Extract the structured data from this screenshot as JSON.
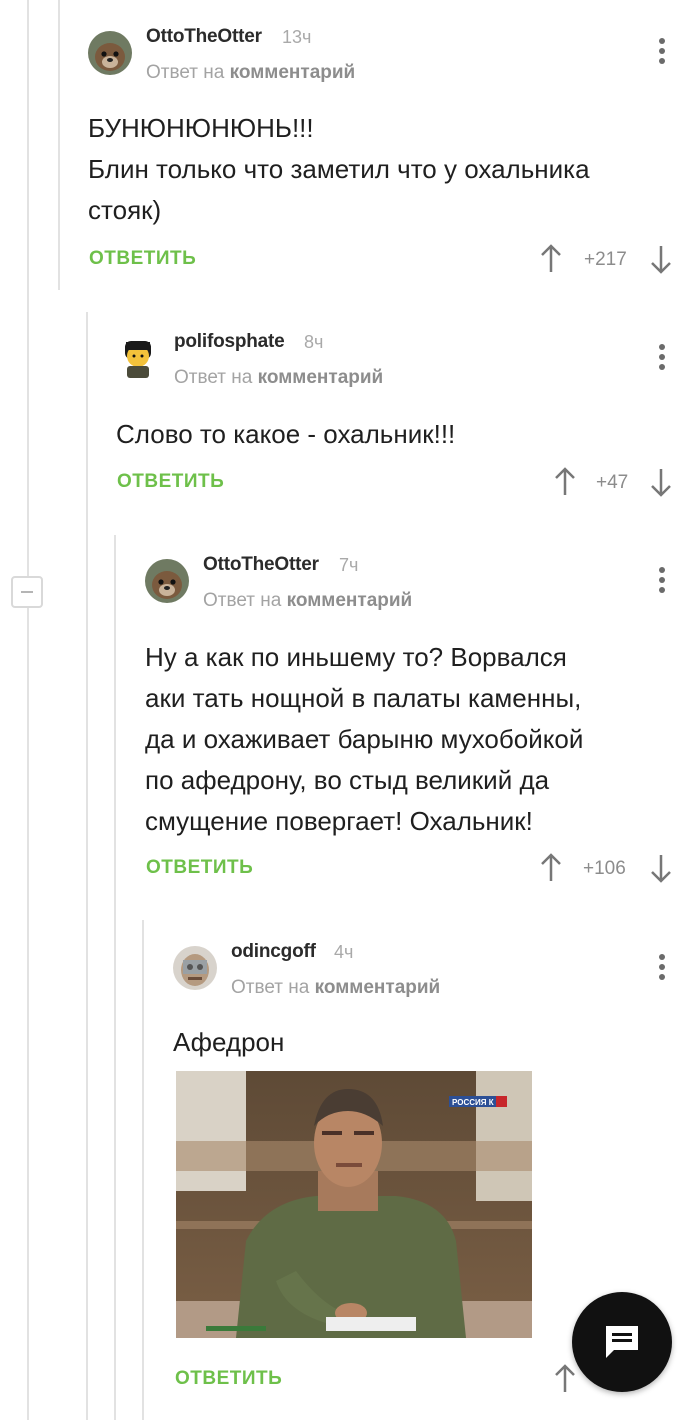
{
  "comments": [
    {
      "username": "OttoTheOtter",
      "time": "13ч",
      "reply_prefix": "Ответ на",
      "reply_target": "комментарий",
      "lines": [
        "БУНЮНЮНЮНЬ!!!",
        "Блин только что заметил что у охальника",
        "стояк)"
      ],
      "reply_label": "ОТВЕТИТЬ",
      "score": "+217",
      "avatar": "otter-avatar"
    },
    {
      "username": "polifosphate",
      "time": "8ч",
      "reply_prefix": "Ответ на",
      "reply_target": "комментарий",
      "lines": [
        "Слово то какое - охальник!!!"
      ],
      "reply_label": "ОТВЕТИТЬ",
      "score": "+47",
      "avatar": "cartoon-avatar"
    },
    {
      "username": "OttoTheOtter",
      "time": "7ч",
      "reply_prefix": "Ответ на",
      "reply_target": "комментарий",
      "lines": [
        "Ну а как по иньшему то? Ворвался",
        "аки тать нощной в палаты каменны,",
        "да и охаживает барыню мухобойкой",
        "по афедрону, во стыд великий да",
        "смущение повергает! Охальник!"
      ],
      "reply_label": "ОТВЕТИТЬ",
      "score": "+106",
      "avatar": "otter-avatar"
    },
    {
      "username": "odincgoff",
      "time": "4ч",
      "reply_prefix": "Ответ на",
      "reply_target": "комментарий",
      "lines": [
        "Афедрон"
      ],
      "reply_label": "ОТВЕТИТЬ",
      "image_logo": "РОССИЯ К",
      "avatar": "masked-avatar"
    }
  ],
  "colors": {
    "accent": "#6ec04a",
    "fab": "#111111"
  }
}
